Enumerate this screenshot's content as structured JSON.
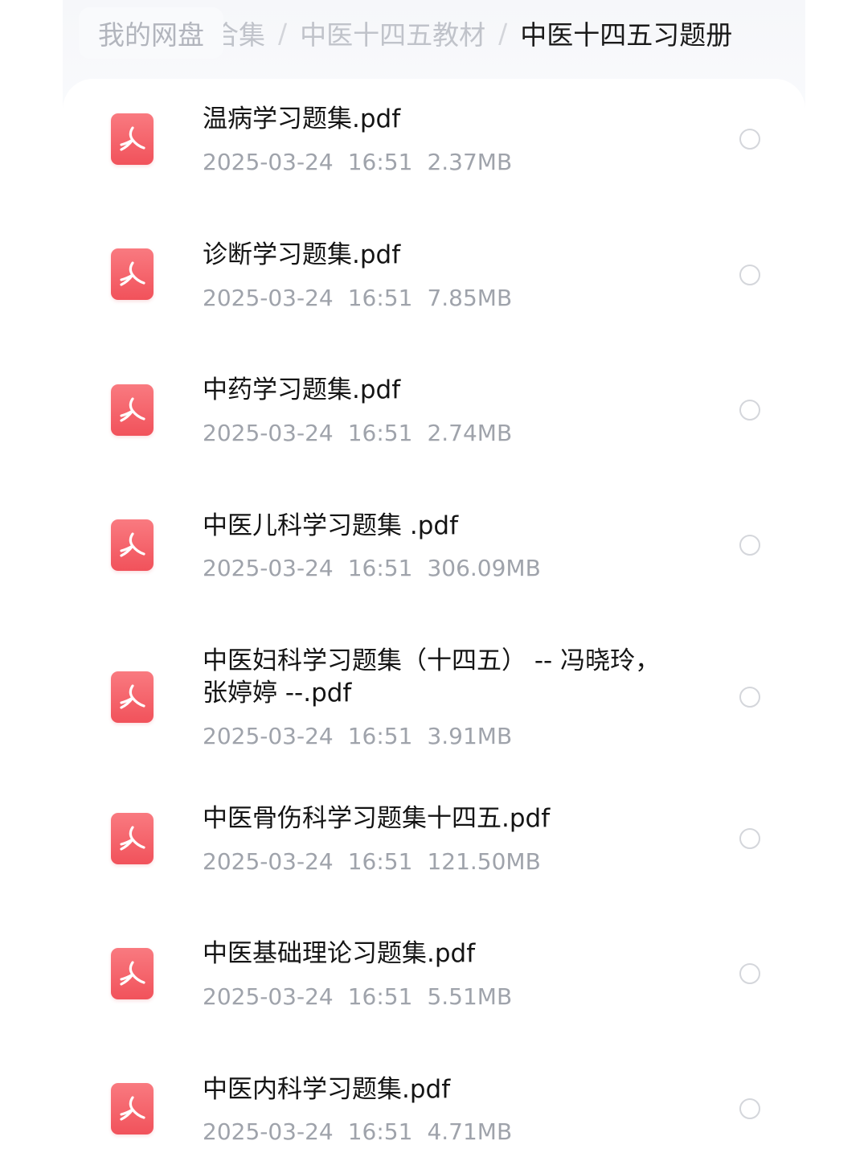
{
  "breadcrumb": {
    "root": "我的网盘",
    "partial": "合集",
    "separator": "/",
    "middle": "中医十四五教材",
    "current": "中医十四五习题册"
  },
  "colors": {
    "pdf_icon": "#f1525b",
    "meta_text": "#9fa3ab",
    "name_text": "#141414"
  },
  "files": [
    {
      "icon": "pdf-icon",
      "name": "温病学习题集.pdf",
      "date": "2025-03-24",
      "time": "16:51",
      "size": "2.37MB"
    },
    {
      "icon": "pdf-icon",
      "name": "诊断学习题集.pdf",
      "date": "2025-03-24",
      "time": "16:51",
      "size": "7.85MB"
    },
    {
      "icon": "pdf-icon",
      "name": "中药学习题集.pdf",
      "date": "2025-03-24",
      "time": "16:51",
      "size": "2.74MB"
    },
    {
      "icon": "pdf-icon",
      "name": "中医儿科学习题集 .pdf",
      "date": "2025-03-24",
      "time": "16:51",
      "size": "306.09MB"
    },
    {
      "icon": "pdf-icon",
      "name": "中医妇科学习题集（十四五） -- 冯晓玲，张婷婷 --.pdf",
      "date": "2025-03-24",
      "time": "16:51",
      "size": "3.91MB"
    },
    {
      "icon": "pdf-icon",
      "name": "中医骨伤科学习题集十四五.pdf",
      "date": "2025-03-24",
      "time": "16:51",
      "size": "121.50MB"
    },
    {
      "icon": "pdf-icon",
      "name": "中医基础理论习题集.pdf",
      "date": "2025-03-24",
      "time": "16:51",
      "size": "5.51MB"
    },
    {
      "icon": "pdf-icon",
      "name": "中医内科学习题集.pdf",
      "date": "2025-03-24",
      "time": "16:51",
      "size": "4.71MB"
    }
  ]
}
